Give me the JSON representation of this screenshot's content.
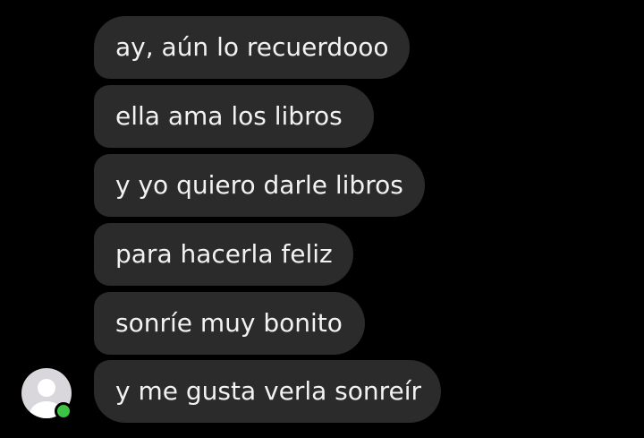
{
  "conversation": {
    "messages": [
      {
        "text": "ay, aún lo recuerdooo"
      },
      {
        "text": "ella ama los libros"
      },
      {
        "text": "y yo quiero darle libros"
      },
      {
        "text": "para hacerla feliz"
      },
      {
        "text": "sonríe muy bonito"
      },
      {
        "text": "y me gusta verla sonreír"
      }
    ],
    "sender": {
      "avatar_icon": "default-user-avatar-icon",
      "status": "online"
    }
  },
  "colors": {
    "background": "#000000",
    "bubble": "#2b2b2b",
    "text": "#f2f2f2",
    "online": "#3ec444"
  }
}
